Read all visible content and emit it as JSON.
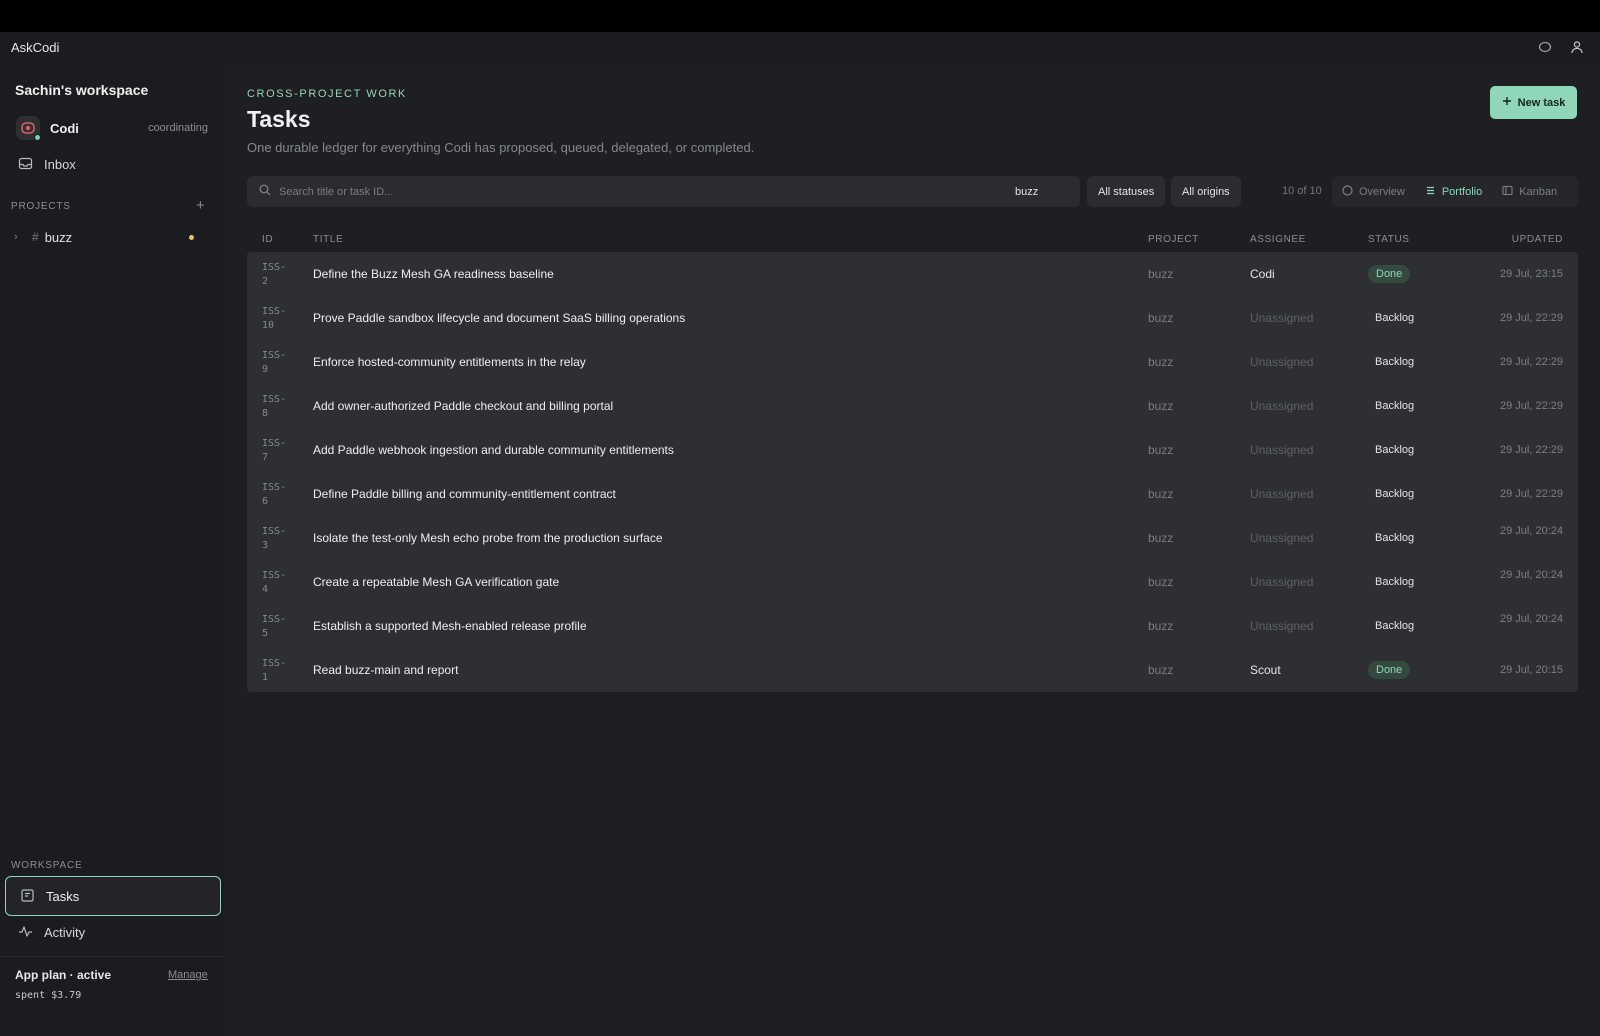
{
  "app": {
    "title": "AskCodi"
  },
  "sidebar": {
    "workspace_name": "Sachin's workspace",
    "agent": {
      "name": "Codi",
      "state": "coordinating"
    },
    "inbox_label": "Inbox",
    "projects_label": "PROJECTS",
    "projects": [
      {
        "name": "buzz"
      }
    ],
    "workspace_label": "WORKSPACE",
    "nav": {
      "tasks": "Tasks",
      "activity": "Activity"
    },
    "plan": {
      "label": "App plan · active",
      "manage": "Manage",
      "spent": "spent $3.79"
    }
  },
  "main": {
    "eyebrow": "CROSS-PROJECT WORK",
    "title": "Tasks",
    "subtitle": "One durable ledger for everything Codi has proposed, queued, delegated, or completed.",
    "new_task_label": "New task",
    "search": {
      "placeholder": "Search title or task ID..."
    },
    "filters": {
      "project": "buzz",
      "status": "All statuses",
      "origin": "All origins"
    },
    "count": "10 of 10",
    "views": {
      "overview": "Overview",
      "portfolio": "Portfolio",
      "kanban": "Kanban",
      "active": "portfolio"
    },
    "columns": {
      "id": "ID",
      "title": "TITLE",
      "project": "PROJECT",
      "assignee": "ASSIGNEE",
      "status": "STATUS",
      "updated": "UPDATED"
    },
    "rows": [
      {
        "id": "ISS-2",
        "title": "Define the Buzz Mesh GA readiness baseline",
        "project": "buzz",
        "assignee": "Codi",
        "status": "Done",
        "updated": "29 Jul, 23:15"
      },
      {
        "id": "ISS-10",
        "title": "Prove Paddle sandbox lifecycle and document SaaS billing operations",
        "project": "buzz",
        "assignee": "Unassigned",
        "status": "Backlog",
        "updated": "29 Jul, 22:29"
      },
      {
        "id": "ISS-9",
        "title": "Enforce hosted-community entitlements in the relay",
        "project": "buzz",
        "assignee": "Unassigned",
        "status": "Backlog",
        "updated": "29 Jul, 22:29"
      },
      {
        "id": "ISS-8",
        "title": "Add owner-authorized Paddle checkout and billing portal",
        "project": "buzz",
        "assignee": "Unassigned",
        "status": "Backlog",
        "updated": "29 Jul, 22:29"
      },
      {
        "id": "ISS-7",
        "title": "Add Paddle webhook ingestion and durable community entitlements",
        "project": "buzz",
        "assignee": "Unassigned",
        "status": "Backlog",
        "updated": "29 Jul, 22:29"
      },
      {
        "id": "ISS-6",
        "title": "Define Paddle billing and community-entitlement contract",
        "project": "buzz",
        "assignee": "Unassigned",
        "status": "Backlog",
        "updated": "29 Jul, 22:29"
      },
      {
        "id": "ISS-3",
        "title": "Isolate the test-only Mesh echo probe from the production surface",
        "project": "buzz",
        "assignee": "Unassigned",
        "status": "Backlog",
        "updated": "29 Jul, 20:24"
      },
      {
        "id": "ISS-4",
        "title": "Create a repeatable Mesh GA verification gate",
        "project": "buzz",
        "assignee": "Unassigned",
        "status": "Backlog",
        "updated": "29 Jul, 20:24"
      },
      {
        "id": "ISS-5",
        "title": "Establish a supported Mesh-enabled release profile",
        "project": "buzz",
        "assignee": "Unassigned",
        "status": "Backlog",
        "updated": "29 Jul, 20:24"
      },
      {
        "id": "ISS-1",
        "title": "Read buzz-main and report",
        "project": "buzz",
        "assignee": "Scout",
        "status": "Done",
        "updated": "29 Jul, 20:15"
      }
    ]
  },
  "colors": {
    "accent": "#8fd7b8",
    "background": "#1e1f22",
    "panel": "#2d2f32",
    "done_badge_bg": "#34493f",
    "project_dot": "#e8c46a"
  },
  "icons": [
    "theme-toggle-icon",
    "user-icon",
    "codi-avatar-icon",
    "inbox-icon",
    "plus-icon",
    "chevron-right-icon",
    "hash-icon",
    "tasks-icon",
    "activity-icon",
    "search-icon",
    "overview-icon",
    "portfolio-icon",
    "kanban-icon"
  ]
}
